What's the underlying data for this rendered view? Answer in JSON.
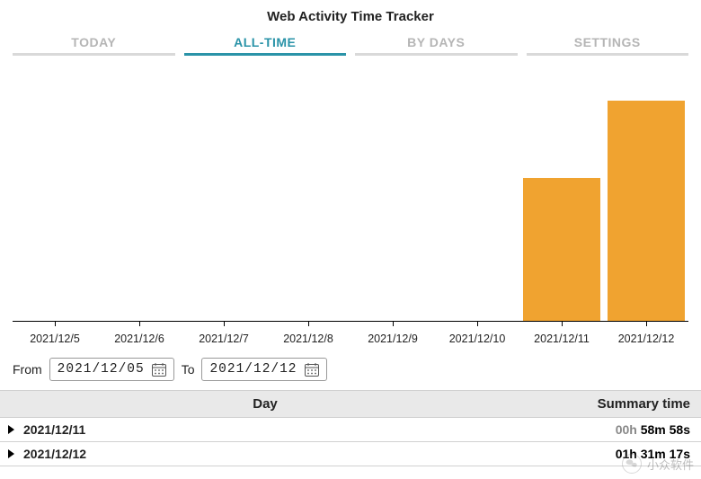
{
  "title": "Web Activity Time Tracker",
  "tabs": [
    {
      "label": "TODAY",
      "active": false
    },
    {
      "label": "ALL-TIME",
      "active": true
    },
    {
      "label": "BY DAYS",
      "active": false
    },
    {
      "label": "SETTINGS",
      "active": false
    }
  ],
  "range": {
    "from_label": "From",
    "from_value": "2021/12/05",
    "to_label": "To",
    "to_value": "2021/12/12"
  },
  "table": {
    "headers": {
      "day": "Day",
      "summary": "Summary time"
    },
    "rows": [
      {
        "day": "2021/12/11",
        "dim": "00h",
        "strong": "58m 58s"
      },
      {
        "day": "2021/12/12",
        "dim": "",
        "strong": "01h 31m 17s"
      }
    ]
  },
  "watermark": "小众软件",
  "chart_data": {
    "type": "bar",
    "title": "",
    "xlabel": "",
    "ylabel": "",
    "ylim": [
      0,
      100
    ],
    "categories": [
      "2021/12/5",
      "2021/12/6",
      "2021/12/7",
      "2021/12/8",
      "2021/12/9",
      "2021/12/10",
      "2021/12/11",
      "2021/12/12"
    ],
    "values": [
      0,
      0,
      0,
      0,
      0,
      0,
      59,
      91
    ],
    "note": "values are approximate minutes of activity; bar heights estimated from pixels since no y-axis shown"
  }
}
